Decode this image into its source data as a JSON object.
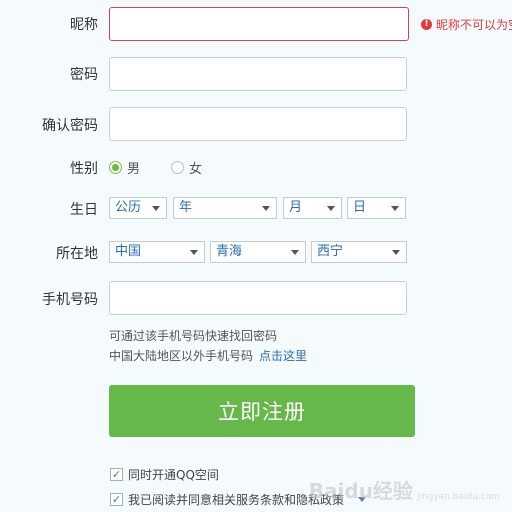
{
  "form": {
    "nickname": {
      "label": "昵称",
      "value": "",
      "error": "昵称不可以为空"
    },
    "password": {
      "label": "密码",
      "value": ""
    },
    "confirm_password": {
      "label": "确认密码",
      "value": ""
    },
    "gender": {
      "label": "性别",
      "options": [
        "男",
        "女"
      ],
      "selected": "男"
    },
    "birthday": {
      "label": "生日",
      "calendar": "公历",
      "year": "年",
      "month": "月",
      "day": "日"
    },
    "location": {
      "label": "所在地",
      "country": "中国",
      "province": "青海",
      "city": "西宁"
    },
    "phone": {
      "label": "手机号码",
      "value": "",
      "tip_line1": "可通过该手机号码快速找回密码",
      "tip_line2": "中国大陆地区以外手机号码",
      "tip_link": "点击这里"
    },
    "submit_label": "立即注册",
    "agreements": [
      {
        "label": "同时开通QQ空间",
        "checked": true
      },
      {
        "label": "我已阅读并同意相关服务条款和隐私政策",
        "checked": true
      }
    ]
  },
  "watermark": {
    "text": "Baidu经验",
    "sub": "jingyan.baidu.com"
  },
  "colors": {
    "accent_green": "#66b84a",
    "error_red": "#e4393c",
    "link_blue": "#2a6db5",
    "background": "#f5fafd"
  },
  "icons": [
    "error-icon",
    "caret-down-icon",
    "checkmark-icon"
  ]
}
